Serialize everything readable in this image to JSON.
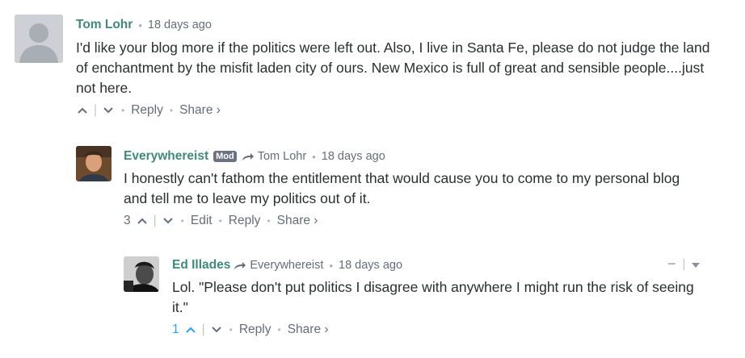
{
  "comments": [
    {
      "author": "Tom Lohr",
      "timestamp": "18 days ago",
      "text": "I'd like your blog more if the politics were left out. Also, I live in Santa Fe, please do not judge the land of enchantment by the misfit laden city of ours. New Mexico is full of great and sensible people....just not here.",
      "actions": {
        "reply": "Reply",
        "share": "Share ›"
      }
    },
    {
      "author": "Everywhereist",
      "badge": "Mod",
      "reply_to": "Tom Lohr",
      "timestamp": "18 days ago",
      "text": "I honestly can't fathom the entitlement that would cause you to come to my personal blog and tell me to leave my politics out of it.",
      "votes": "3",
      "actions": {
        "edit": "Edit",
        "reply": "Reply",
        "share": "Share ›"
      }
    },
    {
      "author": "Ed Illades",
      "reply_to": "Everywhereist",
      "timestamp": "18 days ago",
      "text": "Lol. \"Please don't put politics I disagree with anywhere I might run the risk of seeing it.\"",
      "votes": "1",
      "actions": {
        "reply": "Reply",
        "share": "Share ›"
      },
      "collapse": "−"
    }
  ],
  "colors": {
    "author": "#3f8a7a",
    "meta": "#656c7a",
    "vote_active": "#2e9fff",
    "badge": "#6b7280"
  },
  "icons": [
    "default-avatar-icon",
    "upvote-icon",
    "downvote-icon",
    "reply-arrow-icon",
    "collapse-icon",
    "chevron-down-icon"
  ]
}
